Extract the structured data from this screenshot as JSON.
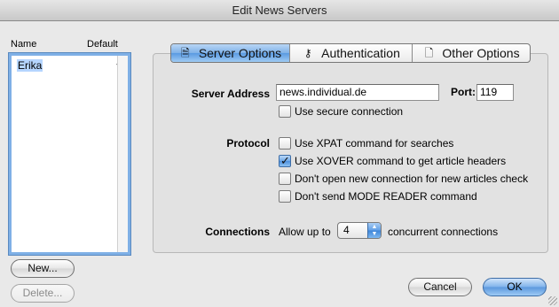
{
  "window": {
    "title": "Edit News Servers"
  },
  "server_list": {
    "headers": {
      "name": "Name",
      "default": "Default"
    },
    "rows": [
      {
        "name": "Erika",
        "default_mark": "√"
      }
    ]
  },
  "list_buttons": {
    "new_label": "New...",
    "delete_label": "Delete..."
  },
  "tabs": [
    {
      "label": "Server Options",
      "icon": "server-options-icon",
      "selected": true
    },
    {
      "label": "Authentication",
      "icon": "authentication-icon",
      "selected": false
    },
    {
      "label": "Other Options",
      "icon": "other-options-icon",
      "selected": false
    }
  ],
  "server_options": {
    "server_address_label": "Server Address",
    "server_address_value": "news.individual.de",
    "port_label": "Port:",
    "port_value": "119",
    "secure_label": "Use secure connection",
    "secure_checked": false,
    "protocol_label": "Protocol",
    "protocol_options": [
      {
        "label": "Use XPAT command for searches",
        "checked": false
      },
      {
        "label": "Use XOVER command to get article headers",
        "checked": true
      },
      {
        "label": "Don't open new connection for new articles check",
        "checked": false
      },
      {
        "label": "Don't send MODE READER command",
        "checked": false
      }
    ],
    "connections_label": "Connections",
    "allow_up_to": "Allow up to",
    "connections_value": "4",
    "concurrent": "concurrent connections"
  },
  "dialog_buttons": {
    "cancel_label": "Cancel",
    "ok_label": "OK"
  },
  "colors": {
    "accent": "#5a9ae2",
    "selection": "#b5d5ff",
    "window_bg": "#e9e9e9"
  }
}
